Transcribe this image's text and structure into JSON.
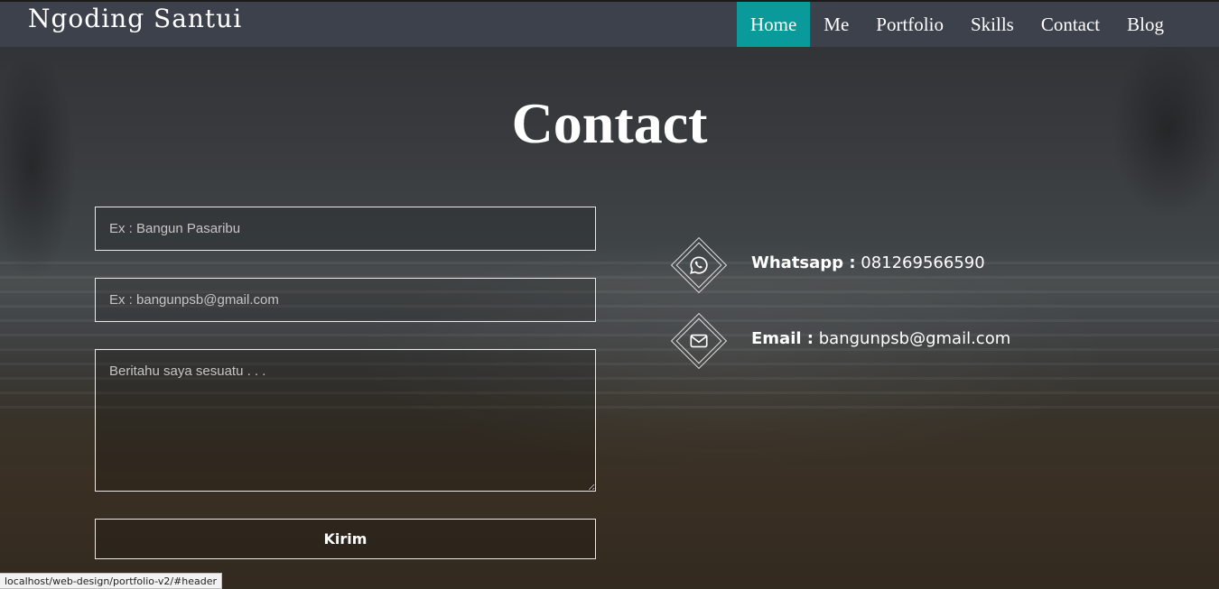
{
  "navbar": {
    "brand": "Ngoding Santui",
    "links": [
      {
        "label": "Home",
        "active": true
      },
      {
        "label": "Me",
        "active": false
      },
      {
        "label": "Portfolio",
        "active": false
      },
      {
        "label": "Skills",
        "active": false
      },
      {
        "label": "Contact",
        "active": false
      },
      {
        "label": "Blog",
        "active": false
      }
    ],
    "active_color": "#0b9a9b"
  },
  "contact": {
    "title": "Contact",
    "form": {
      "name_placeholder": "Ex : Bangun Pasaribu",
      "email_placeholder": "Ex : bangunpsb@gmail.com",
      "message_placeholder": "Beritahu saya sesuatu . . .",
      "submit_label": "Kirim"
    },
    "items": [
      {
        "icon": "whatsapp-icon",
        "label": "Whatsapp :",
        "value": "081269566590"
      },
      {
        "icon": "envelope-icon",
        "label": "Email :",
        "value": "bangunpsb@gmail.com"
      }
    ]
  },
  "status_bar": {
    "url": "localhost/web-design/portfolio-v2/#header"
  }
}
